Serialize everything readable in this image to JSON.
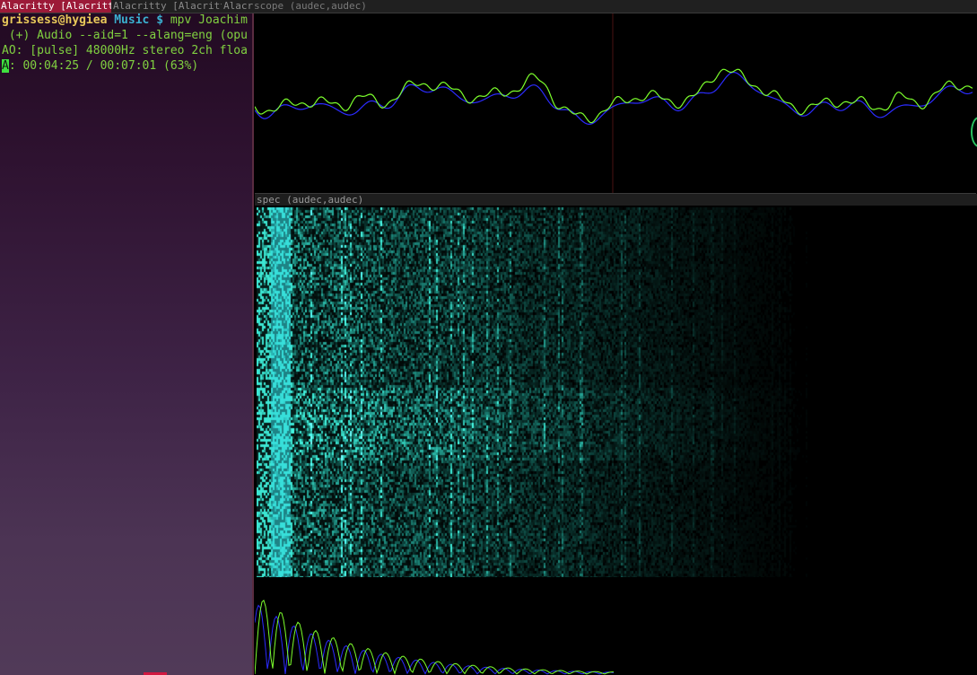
{
  "tabs": [
    {
      "label": "Alacritty [Alacritty",
      "active": true
    },
    {
      "label": "Alacritty [Alacritty",
      "active": false
    },
    {
      "label": "Alacr",
      "active": false
    },
    {
      "label": "scope (audec,audec)",
      "active": false
    }
  ],
  "terminal": {
    "prompt_user": "grissess@hygiea",
    "prompt_dir": "Music",
    "prompt_symbol": "$",
    "command": "mpv Joachim",
    "line_audio": " (+) Audio --aid=1 --alang=eng (opu",
    "line_ao": "AO: [pulse] 48000Hz stereo 2ch floa",
    "status_cursor": "A",
    "status_rest": ": 00:04:25 / 00:07:01 (63%)"
  },
  "spec": {
    "title": "spec (audec,audec)"
  },
  "colors": {
    "tab_active": "#9c1a38",
    "scope_ch1": "#7cff2c",
    "scope_ch2": "#2b2bff",
    "spectro_accent": "#33d8e0"
  }
}
